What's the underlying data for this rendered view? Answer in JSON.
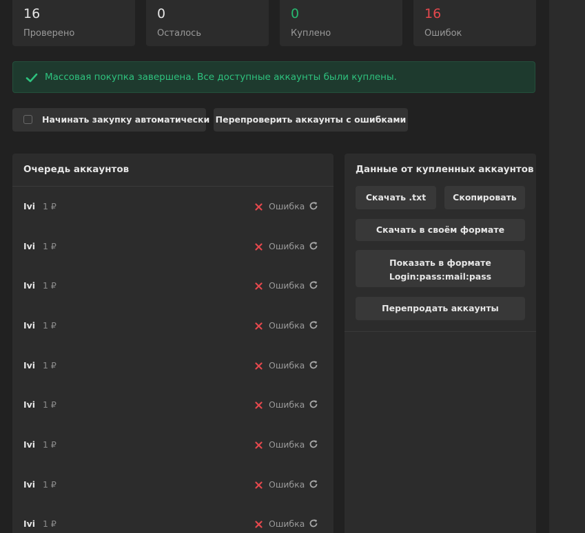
{
  "stats": [
    {
      "value": "16",
      "label": "Проверено"
    },
    {
      "value": "0",
      "label": "Осталось"
    },
    {
      "value": "0",
      "label": "Куплено"
    },
    {
      "value": "16",
      "label": "Ошибок"
    }
  ],
  "colors": {
    "success": "#2ec27e",
    "error": "#e5484d",
    "panel": "#2c2c2c",
    "background": "#212121"
  },
  "alert": {
    "icon": "check-icon",
    "text": "Массовая покупка завершена. Все доступные аккаунты были куплены."
  },
  "controls": {
    "auto_purchase_label": "Начинать закупку автоматически",
    "auto_purchase_checked": false,
    "recheck_label": "Перепроверить аккаунты с ошибками"
  },
  "queue": {
    "title": "Очередь аккаунтов",
    "rows": [
      {
        "name": "Ivi",
        "price": "1 ₽",
        "status": "Ошибка"
      },
      {
        "name": "Ivi",
        "price": "1 ₽",
        "status": "Ошибка"
      },
      {
        "name": "Ivi",
        "price": "1 ₽",
        "status": "Ошибка"
      },
      {
        "name": "Ivi",
        "price": "1 ₽",
        "status": "Ошибка"
      },
      {
        "name": "Ivi",
        "price": "1 ₽",
        "status": "Ошибка"
      },
      {
        "name": "Ivi",
        "price": "1 ₽",
        "status": "Ошибка"
      },
      {
        "name": "Ivi",
        "price": "1 ₽",
        "status": "Ошибка"
      },
      {
        "name": "Ivi",
        "price": "1 ₽",
        "status": "Ошибка"
      },
      {
        "name": "Ivi",
        "price": "1 ₽",
        "status": "Ошибка"
      }
    ]
  },
  "purchased": {
    "title": "Данные от купленных аккаунтов",
    "download_txt": "Скачать .txt",
    "copy": "Скопировать",
    "download_custom": "Скачать в своём формате",
    "show_format_line1": "Показать в формате",
    "show_format_line2": "Login:pass:mail:pass",
    "resell": "Перепродать аккаунты"
  }
}
